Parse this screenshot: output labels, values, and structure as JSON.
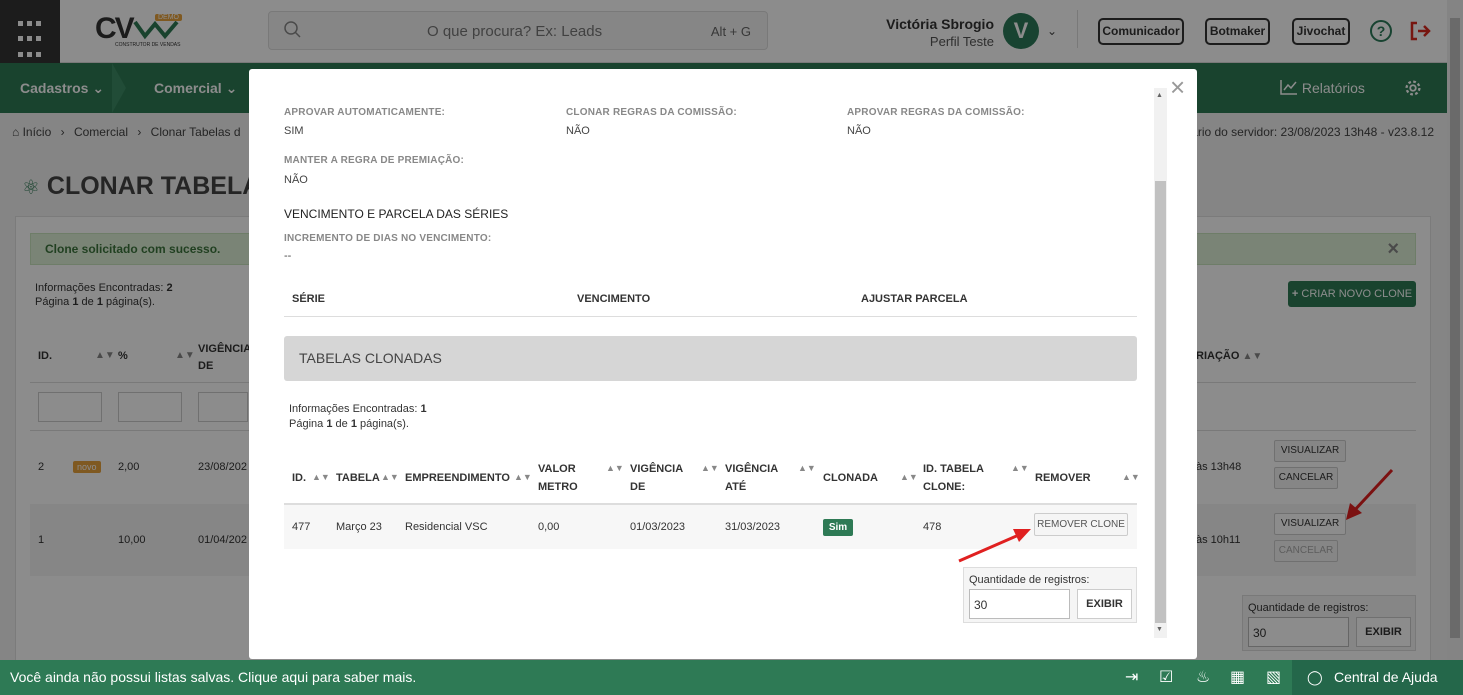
{
  "header": {
    "logo_text": "CV",
    "logo_badge": "DEMO",
    "logo_sub": "CONSTRUTOR DE VENDAS",
    "search_placeholder": "O que procura? Ex: Leads",
    "search_shortcut": "Alt + G",
    "user_name": "Victória Sbrogio",
    "user_profile": "Perfil Teste",
    "avatar_initial": "V",
    "buttons": [
      "Comunicador",
      "Botmaker",
      "Jivochat"
    ]
  },
  "nav": {
    "items": [
      "Cadastros",
      "Comercial"
    ],
    "reports": "Relatórios"
  },
  "breadcrumb": {
    "items": [
      "Início",
      "Comercial",
      "Clonar Tabelas d"
    ],
    "server_time": "ário do servidor: 23/08/2023 13h48 - v23.8.12"
  },
  "page": {
    "title": "CLONAR TABELA",
    "success_msg": "Clone solicitado com sucesso.",
    "info_label": "Informações Encontradas:",
    "info_count": "2",
    "page_label_a": "Página",
    "page_num": "1",
    "page_label_b": "de",
    "page_total": "1",
    "page_label_c": "página(s).",
    "new_clone": "CRIAR NOVO CLONE",
    "columns": [
      "ID.",
      "%",
      "VIGÊNCIA",
      "DE",
      "RIAÇÃO"
    ],
    "rows": [
      {
        "id": "2",
        "badge": "novo",
        "pct": "2,00",
        "date": "23/08/202",
        "created": "às 13h48"
      },
      {
        "id": "1",
        "badge": "",
        "pct": "10,00",
        "date": "01/04/202",
        "created": "às 10h11"
      }
    ],
    "btn_view": "VISUALIZAR",
    "btn_cancel": "CANCELAR",
    "qty_label": "Quantidade de registros:",
    "qty_value": "30",
    "qty_btn": "EXIBIR"
  },
  "modal": {
    "fields": [
      {
        "label": "APROVAR AUTOMATICAMENTE:",
        "value": "SIM"
      },
      {
        "label": "CLONAR REGRAS DA COMISSÃO:",
        "value": "NÃO"
      },
      {
        "label": "APROVAR REGRAS DA COMISSÃO:",
        "value": "NÃO"
      },
      {
        "label": "MANTER A REGRA DE PREMIAÇÃO:",
        "value": "NÃO"
      }
    ],
    "venc_title": "VENCIMENTO E PARCELA DAS SÉRIES",
    "incr_label": "INCREMENTO DE DIAS NO VENCIMENTO:",
    "incr_value": "--",
    "serie_headers": [
      "SÉRIE",
      "VENCIMENTO",
      "AJUSTAR PARCELA"
    ],
    "cloned_title": "TABELAS CLONADAS",
    "info_count": "1",
    "table_headers": {
      "id": "ID.",
      "tabela": "TABELA",
      "emp": "EMPREENDIMENTO",
      "valor1": "VALOR",
      "valor2": "METRO",
      "vigde1": "VIGÊNCIA",
      "vigde2": "DE",
      "vigate1": "VIGÊNCIA",
      "vigate2": "ATÉ",
      "clonada": "CLONADA",
      "idclone1": "ID. TABELA",
      "idclone2": "CLONE:",
      "remover": "REMOVER"
    },
    "row": {
      "id": "477",
      "tabela": "Março 23",
      "emp": "Residencial VSC",
      "valor": "0,00",
      "vig_de": "01/03/2023",
      "vig_ate": "31/03/2023",
      "clonada": "Sim",
      "id_clone": "478",
      "remove_btn": "REMOVER CLONE"
    }
  },
  "footer": {
    "message": "Você ainda não possui listas salvas. Clique aqui para saber mais.",
    "help": "Central de Ajuda"
  },
  "colors": {
    "brand_green": "#2e7a55",
    "arrow_red": "#e02020"
  }
}
